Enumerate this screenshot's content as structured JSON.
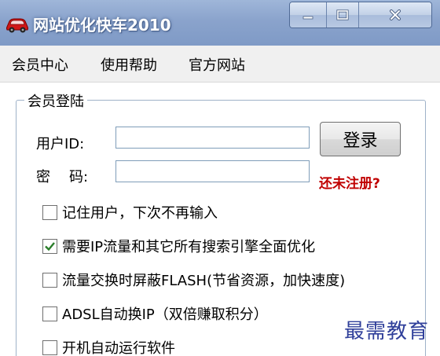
{
  "window": {
    "title": "网站优化快车2010",
    "icon": "red-car-icon",
    "controls": {
      "minimize": "minimize-icon",
      "maximize": "maximize-icon",
      "close": "close-icon"
    }
  },
  "menu": [
    {
      "label": "会员中心"
    },
    {
      "label": "使用帮助"
    },
    {
      "label": "官方网站"
    }
  ],
  "login": {
    "group_title": "会员登陆",
    "user_label": "用户ID:",
    "user_value": "",
    "password_label_1": "密",
    "password_label_2": "码:",
    "password_value": "",
    "login_button": "登录",
    "register_link": "还未注册?"
  },
  "options": [
    {
      "label": "记住用户，下次不再输入",
      "checked": false
    },
    {
      "label": "需要IP流量和其它所有搜索引擎全面优化",
      "checked": true
    },
    {
      "label": "流量交换时屏蔽FLASH(节省资源，加快速度)",
      "checked": false
    },
    {
      "label": "ADSL自动换IP（双倍赚取积分）",
      "checked": false
    },
    {
      "label": "开机自动运行软件",
      "checked": false
    }
  ],
  "watermark": "最需教育",
  "colors": {
    "title_bar": "#8aa3cc",
    "register_link": "#c00000",
    "watermark": "#2f3f9a",
    "check_mark": "#2a7d2a"
  }
}
